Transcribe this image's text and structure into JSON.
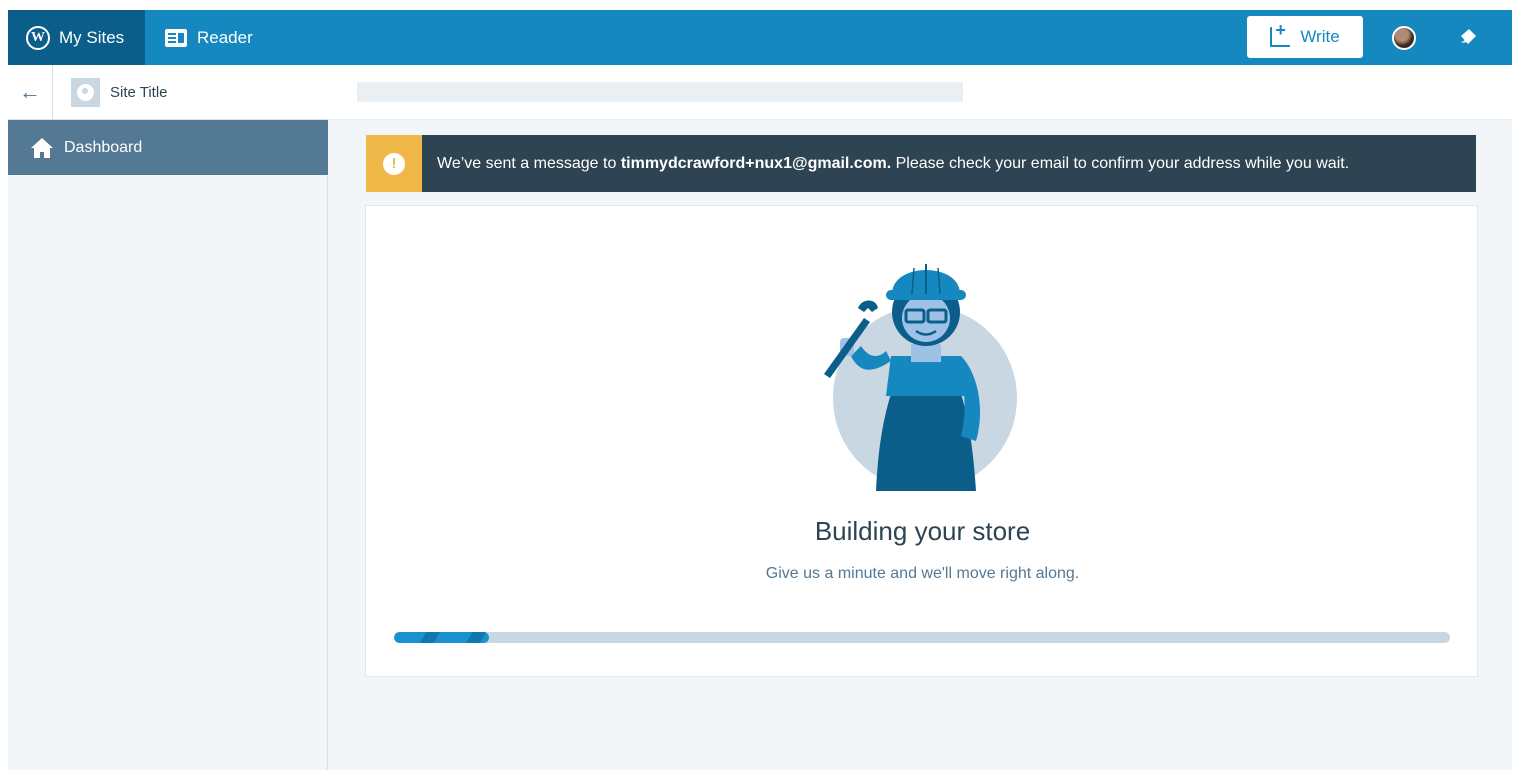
{
  "masterbar": {
    "my_sites_label": "My Sites",
    "reader_label": "Reader",
    "write_label": "Write",
    "icons": [
      "wordpress-logo-icon",
      "reader-icon",
      "write-icon",
      "avatar",
      "notifications-icon"
    ]
  },
  "sidebar": {
    "site_title": "Site Title",
    "items": [
      {
        "label": "Dashboard",
        "icon": "home-icon"
      }
    ]
  },
  "notice": {
    "prefix": "We’ve sent a message to",
    "email": "timmydcrawford+nux1@gmail.com.",
    "suffix": "Please check your email to confirm your address while you wait.",
    "status_color": "#f0b849"
  },
  "store_setup": {
    "title": "Building your store",
    "subtitle": "Give us a minute and we'll move right along.",
    "progress": 0.09
  },
  "colors": {
    "masterbar": "#1688c0",
    "masterbar_active": "#0b5d8a",
    "sidebar_selected": "#537994",
    "progress": "#1a91d0"
  }
}
